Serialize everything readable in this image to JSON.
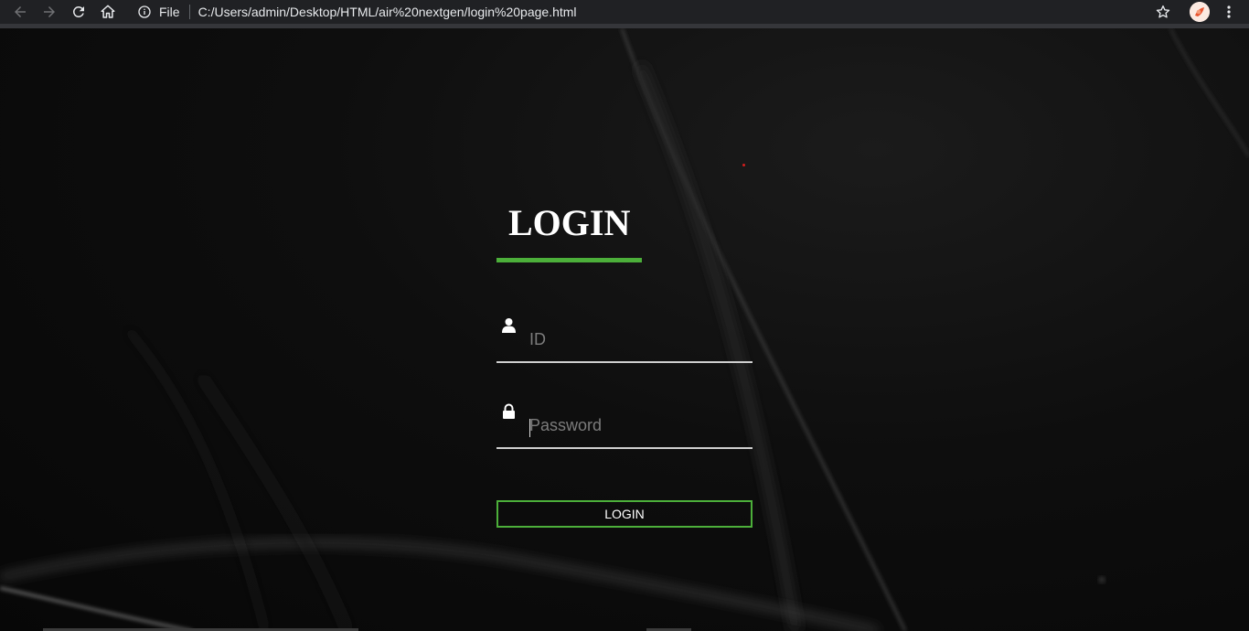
{
  "browser": {
    "scheme_label": "File",
    "url": "C:/Users/admin/Desktop/HTML/air%20nextgen/login%20page.html",
    "icons": [
      "back-icon",
      "forward-icon",
      "reload-icon",
      "home-icon",
      "info-icon",
      "star-icon",
      "profile-avatar",
      "kebab-menu-icon"
    ]
  },
  "login": {
    "title": "LOGIN",
    "id_placeholder": "ID",
    "password_placeholder": "Password",
    "button_label": "LOGIN"
  },
  "colors": {
    "accent": "#4caf3a",
    "background": "#0b0b0b",
    "text": "#ffffff"
  }
}
